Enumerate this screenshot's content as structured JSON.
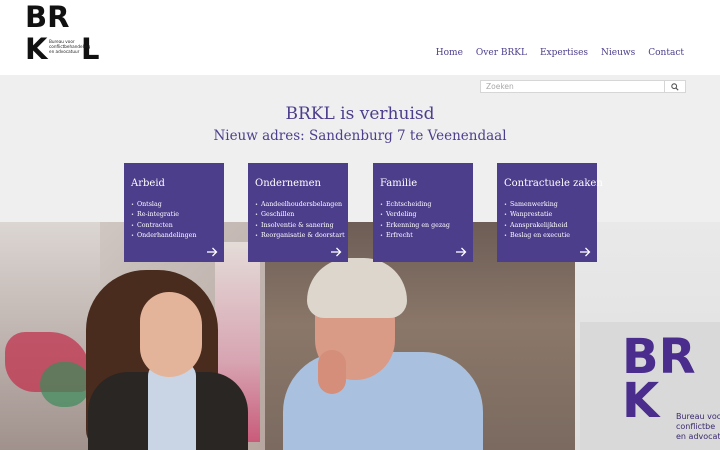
{
  "logo": {
    "line1": "BR",
    "letter_k": "K",
    "letter_l": "L",
    "tagline": [
      "Bureau voor",
      "conflictbehandeling",
      "en advocatuur"
    ]
  },
  "nav": {
    "items": [
      "Home",
      "Over BRKL",
      "Expertises",
      "Nieuws",
      "Contact"
    ]
  },
  "search": {
    "placeholder": "Zoeken",
    "button_icon": "search-icon"
  },
  "headline": {
    "title": "BRKL is verhuisd",
    "subtitle": "Nieuw adres: Sandenburg 7 te Veenendaal"
  },
  "cards": [
    {
      "title": "Arbeid",
      "items": [
        "Ontslag",
        "Re-integratie",
        "Contracten",
        "Onderhandelingen"
      ],
      "icon": "arrow-right-icon"
    },
    {
      "title": "Ondernemen",
      "items": [
        "Aandeelhoudersbelangen",
        "Geschillen",
        "Insolventie & sanering",
        "Reorganisatie & doorstart"
      ],
      "icon": "arrow-right-icon"
    },
    {
      "title": "Familie",
      "items": [
        "Echtscheiding",
        "Verdeling",
        "Erkenning en gezag",
        "Erfrecht"
      ],
      "icon": "arrow-right-icon"
    },
    {
      "title": "Contractuele zaken",
      "items": [
        "Samenwerking",
        "Wanprestatie",
        "Aansprakelijkheid",
        "Beslag en executie"
      ],
      "icon": "arrow-right-icon"
    }
  ],
  "photo": {
    "sign_text": [
      "BR",
      "K"
    ],
    "sign_tagline": [
      "Bureau voo",
      "conflictbe",
      "en advocat"
    ]
  },
  "colors": {
    "brand_purple": "#4d3e8c",
    "background": "#efefef",
    "header": "#ffffff"
  }
}
